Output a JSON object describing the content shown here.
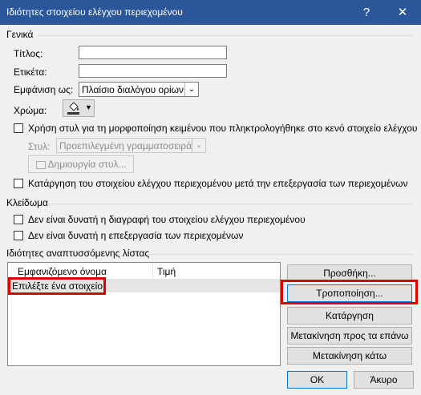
{
  "window": {
    "title": "Ιδιότητες στοιχείου ελέγχου περιεχομένου",
    "help_glyph": "?",
    "close_glyph": "✕"
  },
  "general": {
    "group_label": "Γενικά",
    "title_label": "Τίτλος:",
    "title_value": "",
    "tag_label": "Ετικέτα:",
    "tag_value": "",
    "show_as_label": "Εμφάνιση ως:",
    "show_as_value": "Πλαίσιο διαλόγου ορίων",
    "color_label": "Χρώμα:",
    "use_style_label": "Χρήση στυλ για τη μορφοποίηση κειμένου που πληκτρολογήθηκε στο κενό στοιχείο ελέγχου",
    "style_label": "Στυλ:",
    "style_value": "Προεπιλεγμένη γραμματοσειρά",
    "new_style_label": "Δημιουργία στυλ...",
    "remove_label": "Κατάργηση του στοιχείου ελέγχου περιεχομένου μετά την επεξεργασία των περιεχομένων"
  },
  "locking": {
    "group_label": "Κλείδωμα",
    "no_delete_label": "Δεν είναι δυνατή η διαγραφή του στοιχείου ελέγχου περιεχομένου",
    "no_edit_label": "Δεν είναι δυνατή η επεξεργασία των περιεχομένων"
  },
  "dropdown_props": {
    "group_label": "Ιδιότητες αναπτυσσόμενης λίστας",
    "columns": [
      "Εμφανιζόμενο όνομα",
      "Τιμή"
    ],
    "rows": [
      {
        "display_name": "Επιλέξτε ένα στοιχείο.",
        "value": ""
      }
    ],
    "buttons": {
      "add": "Προσθήκη...",
      "modify": "Τροποποίηση...",
      "remove": "Κατάργηση",
      "move_up": "Μετακίνηση προς τα επάνω",
      "move_down": "Μετακίνηση κάτω"
    }
  },
  "footer": {
    "ok": "OK",
    "cancel": "Άκυρο"
  },
  "colors": {
    "titlebar": "#2b579a",
    "highlight": "#e00000",
    "selected_row": "#e5e5e5"
  }
}
